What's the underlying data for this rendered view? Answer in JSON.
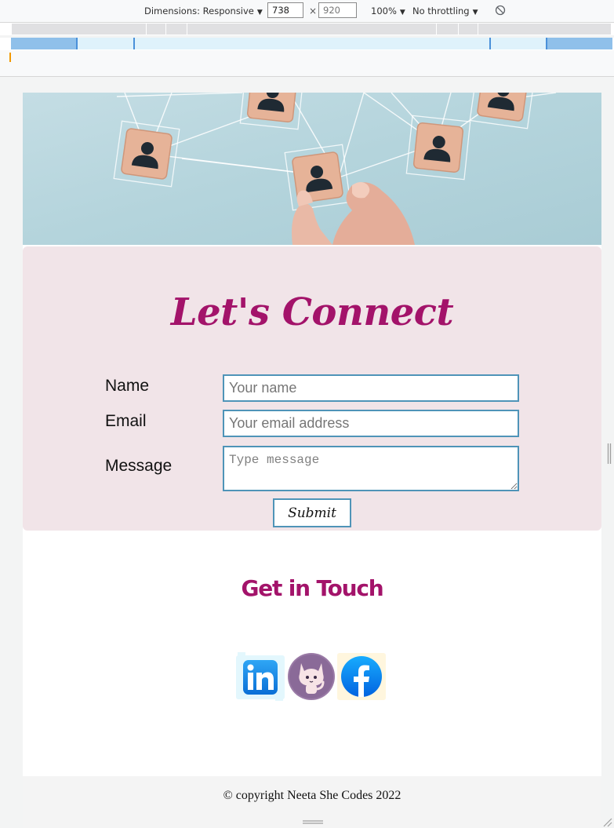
{
  "devtools": {
    "dimensions_label": "Dimensions: Responsive",
    "width_value": "738",
    "height_placeholder": "920",
    "times": "×",
    "zoom": "100%",
    "throttling": "No throttling",
    "rotate_icon": "rotate-icon"
  },
  "hero": {
    "image_alt": "hands arranging wooden blocks with person icons connected by lines",
    "colors": {
      "background": "#b6d7df",
      "block": "#e8b69c",
      "person": "#1f2a33"
    }
  },
  "connect": {
    "title": "Let's Connect",
    "name_label": "Name",
    "name_placeholder": "Your name",
    "email_label": "Email",
    "email_placeholder": "Your email address",
    "message_label": "Message",
    "message_placeholder": "Type message",
    "submit_label": "Submit",
    "colors": {
      "background": "#f1e4e8",
      "title": "#a3136a",
      "field_border": "#4f94b8"
    }
  },
  "touch": {
    "title": "Get in Touch",
    "links": [
      {
        "name": "LinkedIn",
        "icon": "linkedin-icon"
      },
      {
        "name": "GitHub",
        "icon": "github-icon"
      },
      {
        "name": "Facebook",
        "icon": "facebook-icon"
      }
    ]
  },
  "footer": {
    "text": "© copyright Neeta She Codes 2022"
  }
}
